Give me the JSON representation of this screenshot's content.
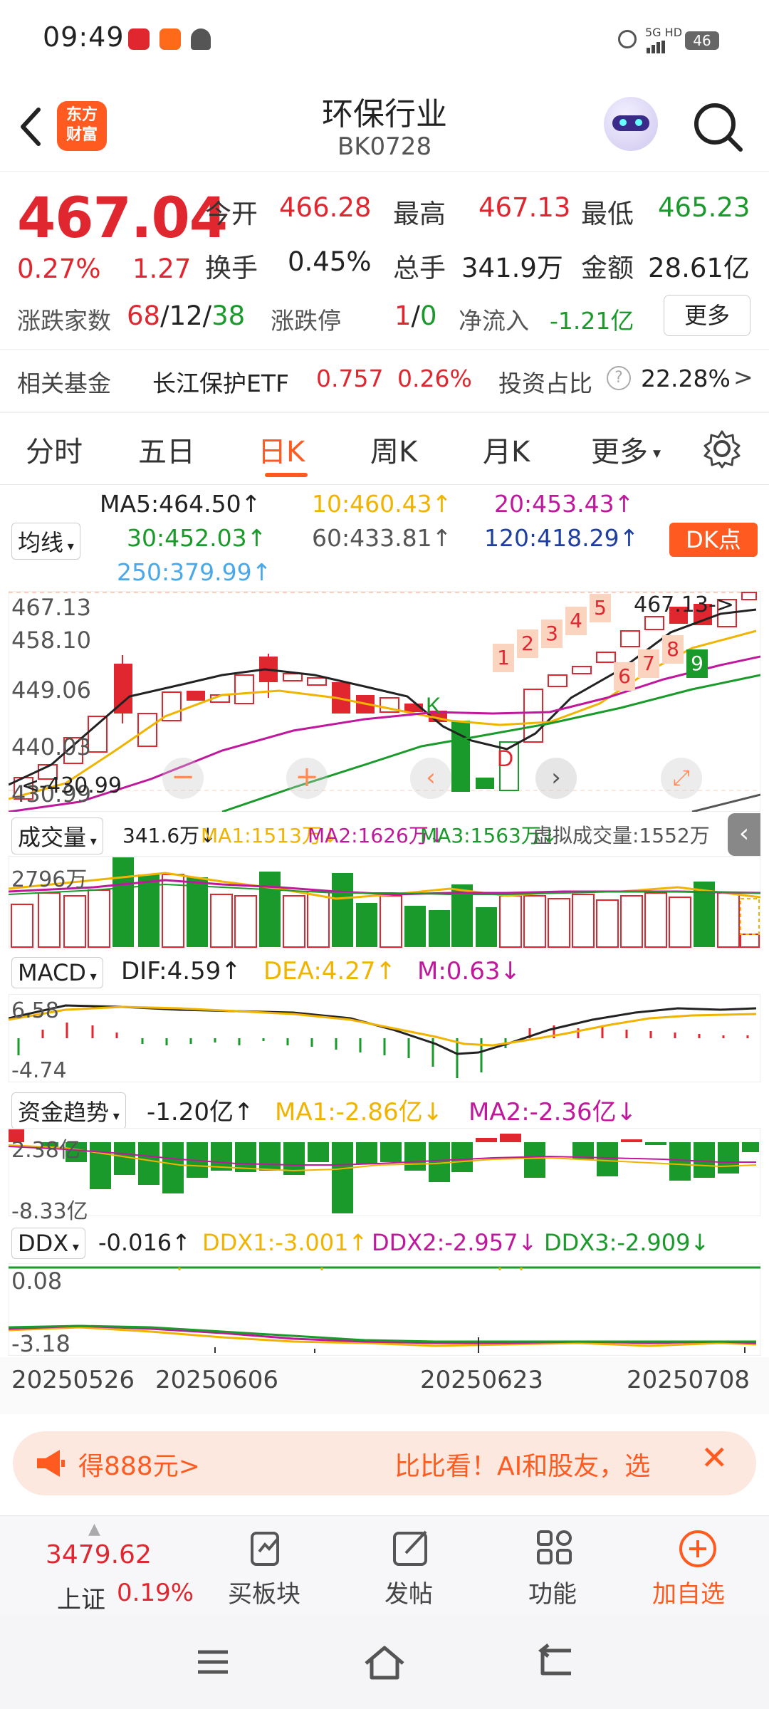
{
  "status": {
    "time": "09:49",
    "network": "5G HD",
    "battery": "46"
  },
  "header": {
    "title": "环保行业",
    "code": "BK0728",
    "logo_line1": "东方",
    "logo_line2": "财富"
  },
  "quote": {
    "price": "467.04",
    "change_pct": "0.27%",
    "change": "1.27",
    "open_label": "今开",
    "open": "466.28",
    "high_label": "最高",
    "high": "467.13",
    "low_label": "最低",
    "low": "465.23",
    "turnover_label": "换手",
    "turnover": "0.45%",
    "volume_label": "总手",
    "volume": "341.9万",
    "amount_label": "金额",
    "amount": "28.61亿",
    "adv_label": "涨跌家数",
    "adv_up": "68",
    "adv_flat": "12",
    "adv_down": "38",
    "limit_label": "涨跌停",
    "limit_up": "1",
    "limit_down": "0",
    "netflow_label": "净流入",
    "netflow": "-1.21亿",
    "more_label": "更多"
  },
  "fund": {
    "label": "相关基金",
    "name": "长江保护ETF",
    "price": "0.757",
    "pct": "0.26%",
    "ratio_label": "投资占比",
    "ratio": "22.28%"
  },
  "tabs": [
    "分时",
    "五日",
    "日K",
    "周K",
    "月K",
    "更多"
  ],
  "ma": {
    "dropdown": "均线",
    "ma5": "MA5:464.50↑",
    "ma10": "10:460.43↑",
    "ma20": "20:453.43↑",
    "ma30": "30:452.03↑",
    "ma60": "60:433.81↑",
    "ma120": "120:418.29↑",
    "ma250": "250:379.99↑",
    "dk_button": "DK点"
  },
  "kline": {
    "y_ticks": [
      "467.13",
      "458.10",
      "449.06",
      "440.03",
      "430.99"
    ],
    "max_label": "467.13->",
    "min_label": "<-430.99",
    "markers": [
      "1",
      "2",
      "3",
      "4",
      "5",
      "6",
      "7",
      "8",
      "9"
    ],
    "k_marker": "K",
    "d_marker": "D"
  },
  "volume": {
    "dropdown": "成交量",
    "value": "341.6万↓",
    "ma1": "MA1:1513万↓",
    "ma2": "MA2:1626万↓",
    "ma3": "MA3:1563万↓",
    "virtual": "虚拟成交量:1552万",
    "y_tick": "2796万"
  },
  "macd": {
    "dropdown": "MACD",
    "dif": "DIF:4.59↑",
    "dea": "DEA:4.27↑",
    "m": "M:0.63↓",
    "y_top": "6.58",
    "y_bottom": "-4.74"
  },
  "capital": {
    "dropdown": "资金趋势",
    "value": "-1.20亿↑",
    "ma1": "MA1:-2.86亿↓",
    "ma2": "MA2:-2.36亿↓",
    "y_top": "2.38亿",
    "y_bottom": "-8.33亿"
  },
  "ddx": {
    "dropdown": "DDX",
    "value": "-0.016↑",
    "ddx1": "DDX1:-3.001↑",
    "ddx2": "DDX2:-2.957↓",
    "ddx3": "DDX3:-2.909↓",
    "y_top": "0.08",
    "y_bottom": "-3.18"
  },
  "dates": [
    "20250526",
    "20250606",
    "20250623",
    "20250708"
  ],
  "banner": {
    "left": "得888元>",
    "right": "比比看！AI和股友，选"
  },
  "ticker": {
    "value": "3479.62",
    "name": "上证",
    "pct": "0.19%"
  },
  "bottom_nav": [
    "买板块",
    "发帖",
    "功能",
    "加自选"
  ],
  "colors": {
    "up": "#e0262f",
    "down": "#1a9a2a",
    "accent": "#ff5a1f",
    "ma5": "#222222",
    "ma10": "#f0b400",
    "ma20": "#c0189c",
    "ma30": "#1a9a2a"
  }
}
